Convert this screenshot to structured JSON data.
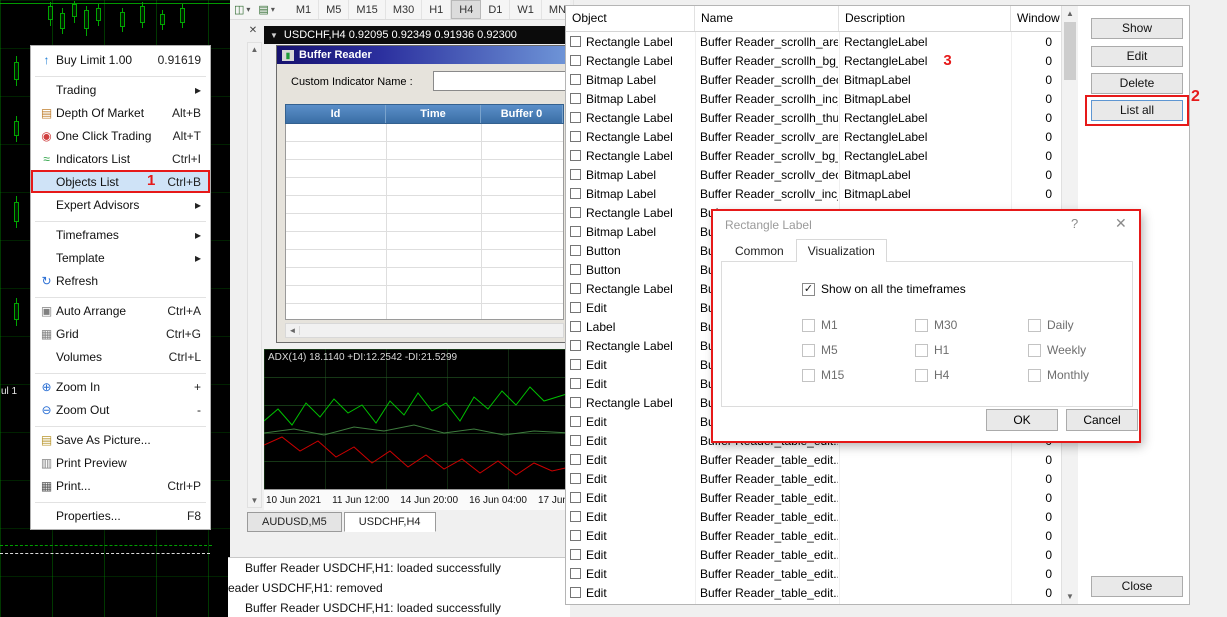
{
  "colors": {
    "annotation_red": "#e61919",
    "chart_green": "#00c000",
    "chart_red": "#cc0000",
    "titlebar_blue_left": "#16116e",
    "titlebar_blue_right": "#6f96d8",
    "table_header_blue": "#3a6ea5",
    "menu_highlight": "#cfe3f7"
  },
  "annotations": {
    "step1": "1",
    "step2": "2",
    "step3": "3"
  },
  "left_chart": {
    "axis_fragment": "ul 1"
  },
  "toolbar": {
    "chart_type_glyph": "◫",
    "chart_mode_glyph": "▤",
    "dropdown_glyph": "▾",
    "timeframes": [
      {
        "label": "M1"
      },
      {
        "label": "M5"
      },
      {
        "label": "M15"
      },
      {
        "label": "M30"
      },
      {
        "label": "H1"
      },
      {
        "label": "H4",
        "active": true
      },
      {
        "label": "D1"
      },
      {
        "label": "W1"
      },
      {
        "label": "MN"
      }
    ]
  },
  "panel_close_glyph": "✕",
  "scroll_glyphs": {
    "up": "▲",
    "down": "▼",
    "left": "◄"
  },
  "chart_window": {
    "collapse_glyph": "▼",
    "title": "USDCHF,H4 0.92095 0.92349 0.91936 0.92300"
  },
  "buffer_reader": {
    "title": "Buffer Reader",
    "title_icon_glyph": "▮",
    "name_label": "Custom Indicator Name :",
    "input_value": "",
    "columns": [
      {
        "label": "Id"
      },
      {
        "label": "Time"
      },
      {
        "label": "Buffer 0"
      }
    ]
  },
  "adx_chart": {
    "indicator_text": "ADX(14) 18.1140 +DI:12.2542 -DI:21.5299",
    "time_axis": [
      {
        "label": "10 Jun 2021"
      },
      {
        "label": "11 Jun 12:00"
      },
      {
        "label": "14 Jun 20:00"
      },
      {
        "label": "16 Jun 04:00"
      },
      {
        "label": "17 Jun"
      }
    ]
  },
  "chart_tabs": [
    {
      "label": "AUDUSD,M5"
    },
    {
      "label": "USDCHF,H4",
      "active": true
    }
  ],
  "journal": {
    "lines": [
      {
        "text": "Buffer Reader USDCHF,H1: loaded successfully",
        "indent": true
      },
      {
        "text": "eader USDCHF,H1: removed"
      },
      {
        "text": "Buffer Reader USDCHF,H1: loaded successfully",
        "indent": true
      }
    ]
  },
  "context_menu": {
    "items": [
      {
        "glyph": "↑",
        "glyph_color": "#1a7ad4",
        "label": "Buy Limit 1.00",
        "right": "0.91619"
      },
      {
        "sep": true
      },
      {
        "label": "Trading",
        "right": "▸"
      },
      {
        "glyph": "▤",
        "glyph_color": "#c08030",
        "label": "Depth Of Market",
        "right": "Alt+B"
      },
      {
        "glyph": "◉",
        "glyph_color": "#d04040",
        "label": "One Click Trading",
        "right": "Alt+T"
      },
      {
        "glyph": "≈",
        "glyph_color": "#1f9d3a",
        "label": "Indicators List",
        "right": "Ctrl+I"
      },
      {
        "label": "Objects List",
        "right": "Ctrl+B",
        "selected": true,
        "badge": "1"
      },
      {
        "label": "Expert Advisors",
        "right": "▸"
      },
      {
        "sep": true
      },
      {
        "label": "Timeframes",
        "right": "▸"
      },
      {
        "label": "Template",
        "right": "▸"
      },
      {
        "glyph": "↻",
        "glyph_color": "#2b6fd4",
        "label": "Refresh"
      },
      {
        "sep": true
      },
      {
        "glyph": "▣",
        "glyph_color": "#808080",
        "label": "Auto Arrange",
        "right": "Ctrl+A"
      },
      {
        "glyph": "▦",
        "glyph_color": "#808080",
        "label": "Grid",
        "right": "Ctrl+G"
      },
      {
        "label": "Volumes",
        "right": "Ctrl+L"
      },
      {
        "sep": true
      },
      {
        "glyph": "⊕",
        "glyph_color": "#2b6fd4",
        "label": "Zoom In",
        "right": "+"
      },
      {
        "glyph": "⊖",
        "glyph_color": "#2b6fd4",
        "label": "Zoom Out",
        "right": "-"
      },
      {
        "sep": true
      },
      {
        "glyph": "▤",
        "glyph_color": "#b8962e",
        "label": "Save As Picture..."
      },
      {
        "glyph": "▥",
        "glyph_color": "#808080",
        "label": "Print Preview"
      },
      {
        "glyph": "▦",
        "glyph_color": "#555555",
        "label": "Print...",
        "right": "Ctrl+P"
      },
      {
        "sep": true
      },
      {
        "label": "Properties...",
        "right": "F8"
      }
    ]
  },
  "objects_dialog": {
    "columns": [
      {
        "label": "Object"
      },
      {
        "label": "Name"
      },
      {
        "label": "Description"
      },
      {
        "label": "Window"
      }
    ],
    "rows": [
      {
        "object": "Rectangle Label",
        "name": "Buffer Reader_scrollh_are...",
        "desc": "RectangleLabel",
        "win": "0"
      },
      {
        "object": "Rectangle Label",
        "name": "Buffer Reader_scrollh_bg_4",
        "desc": "RectangleLabel",
        "win": "0",
        "badge": "3"
      },
      {
        "object": "Bitmap Label",
        "name": "Buffer Reader_scrollh_dec_4",
        "desc": "BitmapLabel",
        "win": "0"
      },
      {
        "object": "Bitmap Label",
        "name": "Buffer Reader_scrollh_inc_4",
        "desc": "BitmapLabel",
        "win": "0"
      },
      {
        "object": "Rectangle Label",
        "name": "Buffer Reader_scrollh_thu...",
        "desc": "RectangleLabel",
        "win": "0"
      },
      {
        "object": "Rectangle Label",
        "name": "Buffer Reader_scrollv_are...",
        "desc": "RectangleLabel",
        "win": "0"
      },
      {
        "object": "Rectangle Label",
        "name": "Buffer Reader_scrollv_bg_4",
        "desc": "RectangleLabel",
        "win": "0"
      },
      {
        "object": "Bitmap Label",
        "name": "Buffer Reader_scrollv_dec_4",
        "desc": "BitmapLabel",
        "win": "0"
      },
      {
        "object": "Bitmap Label",
        "name": "Buffer Reader_scrollv_inc_4",
        "desc": "BitmapLabel",
        "win": "0"
      },
      {
        "object": "Rectangle Label",
        "name": "Buf"
      },
      {
        "object": "Bitmap Label",
        "name": "Buf"
      },
      {
        "object": "Button",
        "name": "Buf"
      },
      {
        "object": "Button",
        "name": "Buf"
      },
      {
        "object": "Rectangle Label",
        "name": "Buf"
      },
      {
        "object": "Edit",
        "name": "Buf"
      },
      {
        "object": "Label",
        "name": "Buf"
      },
      {
        "object": "Rectangle Label",
        "name": "Buf"
      },
      {
        "object": "Edit",
        "name": "Buf"
      },
      {
        "object": "Edit",
        "name": "Buf"
      },
      {
        "object": "Rectangle Label",
        "name": "Buf"
      },
      {
        "object": "Edit",
        "name": "Buf"
      },
      {
        "object": "Edit",
        "name": "Buffer Reader_table_edit...",
        "win": "0"
      },
      {
        "object": "Edit",
        "name": "Buffer Reader_table_edit...",
        "win": "0"
      },
      {
        "object": "Edit",
        "name": "Buffer Reader_table_edit...",
        "win": "0"
      },
      {
        "object": "Edit",
        "name": "Buffer Reader_table_edit...",
        "win": "0"
      },
      {
        "object": "Edit",
        "name": "Buffer Reader_table_edit...",
        "win": "0"
      },
      {
        "object": "Edit",
        "name": "Buffer Reader_table_edit...",
        "win": "0"
      },
      {
        "object": "Edit",
        "name": "Buffer Reader_table_edit...",
        "win": "0"
      },
      {
        "object": "Edit",
        "name": "Buffer Reader_table_edit...",
        "win": "0"
      },
      {
        "object": "Edit",
        "name": "Buffer Reader_table_edit...",
        "win": "0"
      }
    ],
    "buttons": {
      "show": "Show",
      "edit": "Edit",
      "delete": "Delete",
      "list_all": "List all",
      "close": "Close"
    }
  },
  "properties_dialog": {
    "title": "Rectangle Label",
    "help_glyph": "?",
    "close_glyph": "✕",
    "tabs": [
      {
        "label": "Common"
      },
      {
        "label": "Visualization",
        "active": true
      }
    ],
    "show_all_label": "Show on all the timeframes",
    "timeframe_checks": [
      {
        "label": "M1"
      },
      {
        "label": "M30"
      },
      {
        "label": "Daily"
      },
      {
        "label": "M5"
      },
      {
        "label": "H1"
      },
      {
        "label": "Weekly"
      },
      {
        "label": "M15"
      },
      {
        "label": "H4"
      },
      {
        "label": "Monthly"
      }
    ],
    "ok": "OK",
    "cancel": "Cancel"
  }
}
